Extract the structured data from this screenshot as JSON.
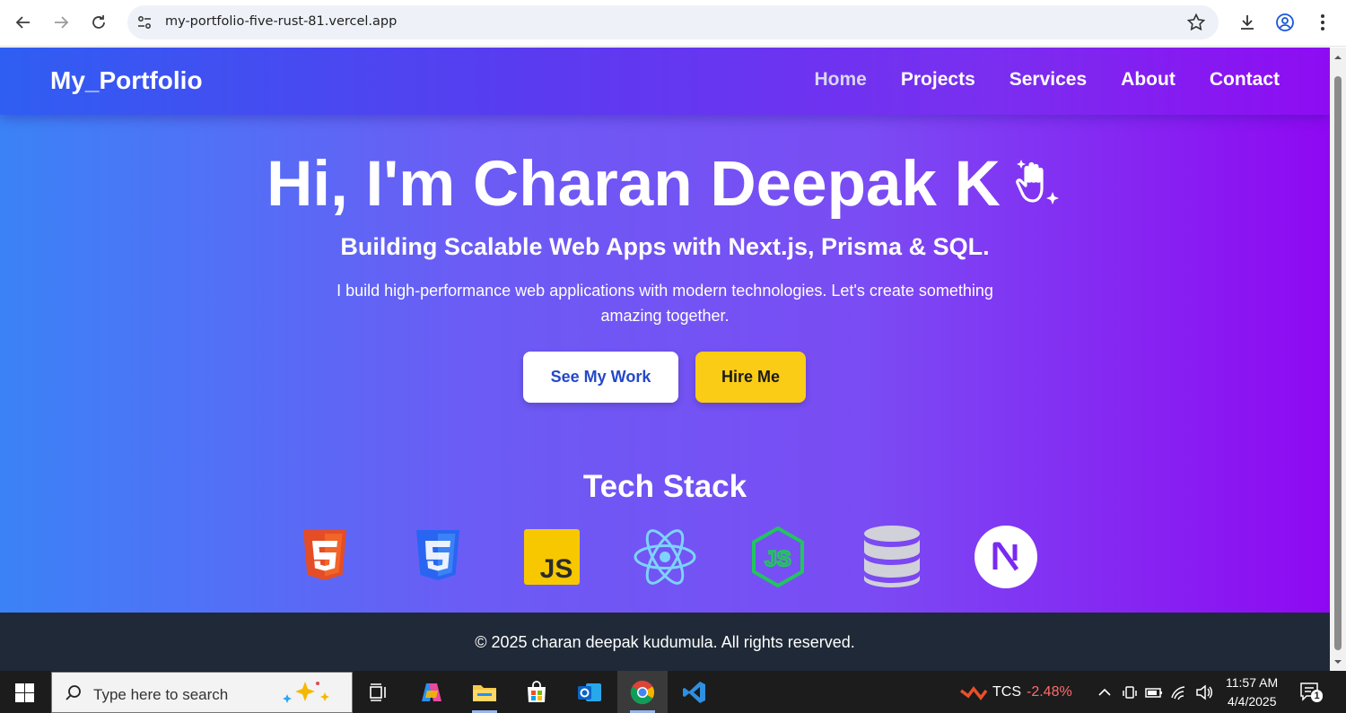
{
  "browser": {
    "url": "my-portfolio-five-rust-81.vercel.app"
  },
  "site": {
    "brand": "My_Portfolio",
    "nav": [
      "Home",
      "Projects",
      "Services",
      "About",
      "Contact"
    ],
    "hero_title": "Hi, I'm Charan Deepak K",
    "hero_subtitle": "Building Scalable Web Apps with Next.js, Prisma & SQL.",
    "hero_text": "I build high-performance web applications with modern technologies. Let's create something amazing together.",
    "btn_work": "See My Work",
    "btn_hire": "Hire Me",
    "tech_title": "Tech Stack",
    "tech_icons": [
      "html5-icon",
      "css3-icon",
      "javascript-icon",
      "react-icon",
      "nodejs-icon",
      "database-icon",
      "nextjs-icon"
    ],
    "footer": "© 2025 charan deepak kudumula. All rights reserved."
  },
  "taskbar": {
    "search_placeholder": "Type here to search",
    "stock_symbol": "TCS",
    "stock_change": "-2.48%",
    "time": "11:57 AM",
    "date": "4/4/2025",
    "notification_count": "1"
  },
  "colors": {
    "accent_blue": "#2448c9",
    "hire_yellow": "#facc15",
    "footer_bg": "#1f2937",
    "stock_red": "#ff6b6b"
  }
}
